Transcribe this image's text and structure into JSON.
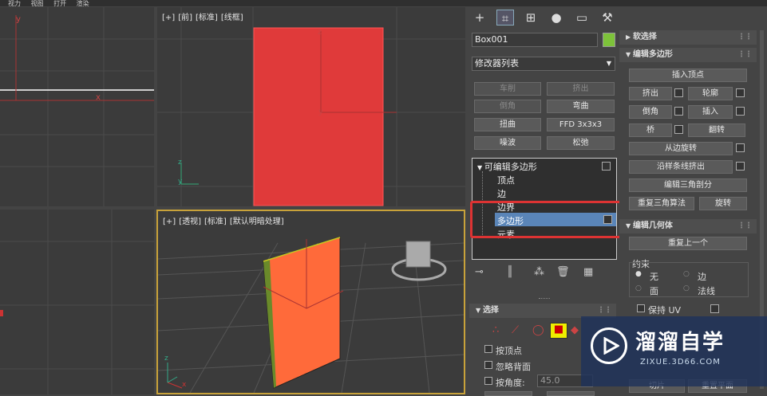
{
  "menubar": {
    "items": [
      "视力",
      "视图",
      "打开",
      "渲染"
    ]
  },
  "viewports": {
    "front": {
      "tags": [
        "[+]",
        "[前]",
        "[标准]",
        "[线框]"
      ]
    },
    "persp": {
      "tags": [
        "[+]",
        "[透视]",
        "[标准]",
        "[默认明暗处理]"
      ]
    }
  },
  "axes": {
    "x": "x",
    "y": "y",
    "z": "z"
  },
  "panel": {
    "tabs": [
      "create-icon",
      "modify-icon",
      "hierarchy-icon",
      "motion-icon",
      "display-icon",
      "utilities-icon"
    ],
    "object_name": "Box001",
    "object_color": "#7dc23a",
    "modifier_list": "修改器列表",
    "mod_buttons": [
      "车削",
      "挤出",
      "倒角",
      "弯曲",
      "扭曲",
      "FFD 3x3x3",
      "噪波",
      "松弛"
    ],
    "stack": {
      "root": "可编辑多边形",
      "items": [
        "顶点",
        "边",
        "边界",
        "多边形",
        "元素"
      ],
      "selected": "多边形"
    },
    "selection_rollout": "选择",
    "sel_options": [
      "按顶点",
      "忽略背面",
      "按角度:"
    ],
    "angle_value": "45.0"
  },
  "rpanel": {
    "soft": "软选择",
    "edit_poly": "编辑多边形",
    "buttons": [
      "插入顶点",
      "挤出",
      "轮廓",
      "倒角",
      "插入",
      "桥",
      "翻转",
      "从边旋转",
      "沿样条线挤出",
      "编辑三角剖分",
      "重复三角算法",
      "旋转"
    ],
    "edit_geom": "编辑几何体",
    "repeat": "重复上一个",
    "constraint": "约束",
    "radios": [
      "无",
      "边",
      "面",
      "法线"
    ],
    "keep_uv": "保持 UV",
    "bottom_buttons": [
      "切片",
      "重置平面"
    ]
  },
  "watermark": {
    "title": "溜溜自学",
    "url": "ZIXUE.3D66.COM"
  }
}
